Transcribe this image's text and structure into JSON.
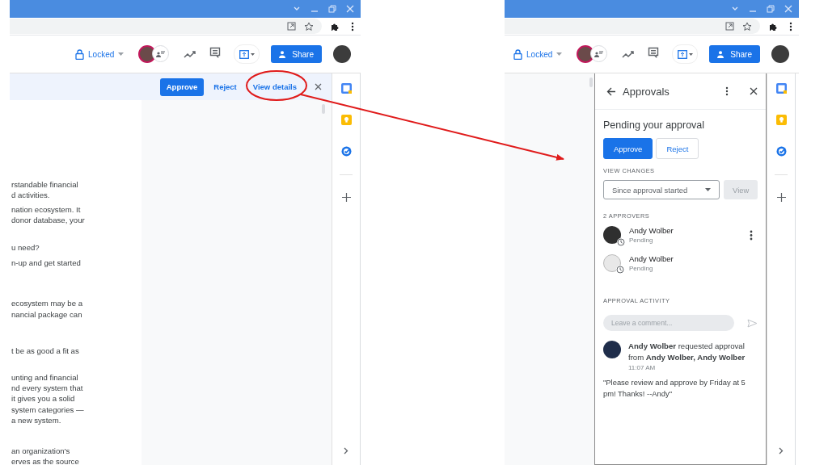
{
  "left_window": {
    "toolbar": {
      "lock_label": "Locked",
      "share_label": "Share"
    },
    "approval_banner": {
      "buttons": [
        {
          "label": "Approve",
          "kind": "primary"
        },
        {
          "label": "Reject",
          "kind": "text"
        },
        {
          "label": "View details",
          "kind": "text"
        }
      ]
    },
    "document_paragraphs": [
      {
        "lines": [
          "rstandable financial",
          "d activities."
        ]
      },
      {
        "lines": [
          "nation ecosystem. It",
          "donor database, your"
        ]
      },
      {
        "lines": [
          "u need?"
        ]
      },
      {
        "lines": [
          "n-up and get started"
        ]
      },
      {
        "lines": [
          "ecosystem may be a",
          "nancial package can"
        ]
      },
      {
        "lines": [
          "t be as good a fit as"
        ]
      },
      {
        "lines": [
          "unting and financial",
          "nd every system that",
          "it gives you a solid",
          "system categories —",
          "a new system."
        ]
      },
      {
        "lines": [
          "an organization's",
          "erves as the source"
        ]
      }
    ]
  },
  "right_window": {
    "toolbar": {
      "lock_label": "Locked",
      "share_label": "Share"
    },
    "approvals_panel": {
      "title": "Approvals",
      "heading": "Pending your approval",
      "buttons": [
        {
          "label": "Approve",
          "kind": "primary"
        },
        {
          "label": "Reject",
          "kind": "outline"
        }
      ],
      "view_changes_label": "VIEW CHANGES",
      "dropdown": {
        "value": "Since approval started"
      },
      "view_button": {
        "label": "View",
        "disabled": true
      },
      "approvers_label": "2 APPROVERS",
      "approvers": [
        {
          "name": "Andy Wolber",
          "status": "Pending",
          "show_menu": true
        },
        {
          "name": "Andy Wolber",
          "status": "Pending",
          "show_menu": false
        }
      ],
      "activity_label": "APPROVAL ACTIVITY",
      "comment_field": {
        "placeholder": "Leave a comment..."
      },
      "activity": [
        {
          "text": "**Andy Wolber** requested approval from **Andy Wolber, Andy Wolber**",
          "time": "11:07 AM"
        }
      ],
      "message": "\"Please review and approve by Friday at 5 pm! Thanks! --Andy\""
    }
  }
}
